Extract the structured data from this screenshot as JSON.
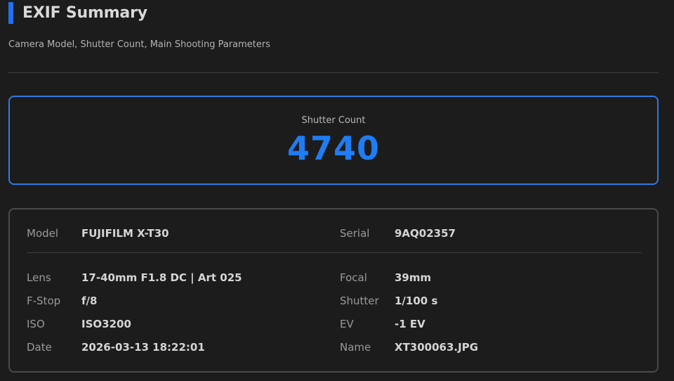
{
  "header": {
    "title": "EXIF Summary",
    "subtitle": "Camera Model, Shutter Count, Main Shooting Parameters",
    "accent_color": "#1e73f0"
  },
  "shutter": {
    "label": "Shutter Count",
    "value": "4740",
    "color": "#1f7cf2"
  },
  "info": {
    "model": {
      "label": "Model",
      "value": "FUJIFILM X-T30"
    },
    "serial": {
      "label": "Serial",
      "value": "9AQ02357"
    },
    "lens": {
      "label": "Lens",
      "value": "17-40mm F1.8 DC | Art 025"
    },
    "focal": {
      "label": "Focal",
      "value": "39mm"
    },
    "fstop": {
      "label": "F-Stop",
      "value": "f/8"
    },
    "shutter_speed": {
      "label": "Shutter",
      "value": "1/100 s"
    },
    "iso": {
      "label": "ISO",
      "value": "ISO3200"
    },
    "ev": {
      "label": "EV",
      "value": "-1 EV"
    },
    "date": {
      "label": "Date",
      "value": "2026-03-13 18:22:01"
    },
    "name": {
      "label": "Name",
      "value": "XT300063.JPG"
    }
  }
}
